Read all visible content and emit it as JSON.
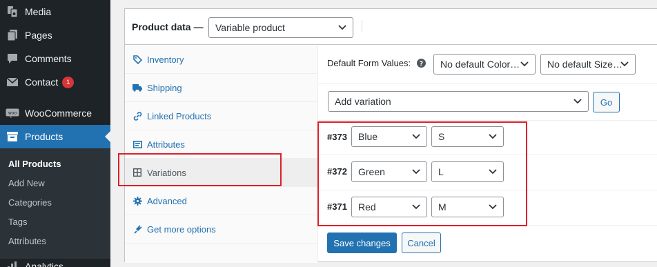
{
  "sidebar": {
    "menu": [
      {
        "key": "media",
        "label": "Media",
        "icon": "media-icon"
      },
      {
        "key": "pages",
        "label": "Pages",
        "icon": "pages-icon"
      },
      {
        "key": "comments",
        "label": "Comments",
        "icon": "comments-icon"
      },
      {
        "key": "contact",
        "label": "Contact",
        "icon": "mail-icon",
        "badge": "1"
      },
      {
        "key": "woocommerce",
        "label": "WooCommerce",
        "icon": "woo-icon"
      },
      {
        "key": "products",
        "label": "Products",
        "icon": "archive-icon",
        "current": true
      }
    ],
    "submenu": [
      "All Products",
      "Add New",
      "Categories",
      "Tags",
      "Attributes"
    ],
    "partial_next_item": "Analytics"
  },
  "product_data": {
    "label": "Product data —",
    "type_select": "Variable product",
    "tabs": [
      {
        "label": "Inventory",
        "icon": "tag-icon"
      },
      {
        "label": "Shipping",
        "icon": "truck-icon"
      },
      {
        "label": "Linked Products",
        "icon": "link-icon"
      },
      {
        "label": "Attributes",
        "icon": "list-icon"
      },
      {
        "label": "Variations",
        "icon": "grid-icon",
        "active": true
      },
      {
        "label": "Advanced",
        "icon": "gear-icon"
      },
      {
        "label": "Get more options",
        "icon": "plugin-icon"
      }
    ]
  },
  "variations": {
    "default_form_label": "Default Form Values:",
    "default_color": "No default Color…",
    "default_size": "No default Size…",
    "add_variation": "Add variation",
    "go_label": "Go",
    "items": [
      {
        "id": "#373",
        "color": "Blue",
        "size": "S"
      },
      {
        "id": "#372",
        "color": "Green",
        "size": "L"
      },
      {
        "id": "#371",
        "color": "Red",
        "size": "M"
      }
    ],
    "save_label": "Save changes",
    "cancel_label": "Cancel"
  },
  "colors": {
    "admin_bg": "#1d2327",
    "accent": "#2271b1",
    "highlight": "#dd1f2a",
    "badge": "#d63638"
  }
}
